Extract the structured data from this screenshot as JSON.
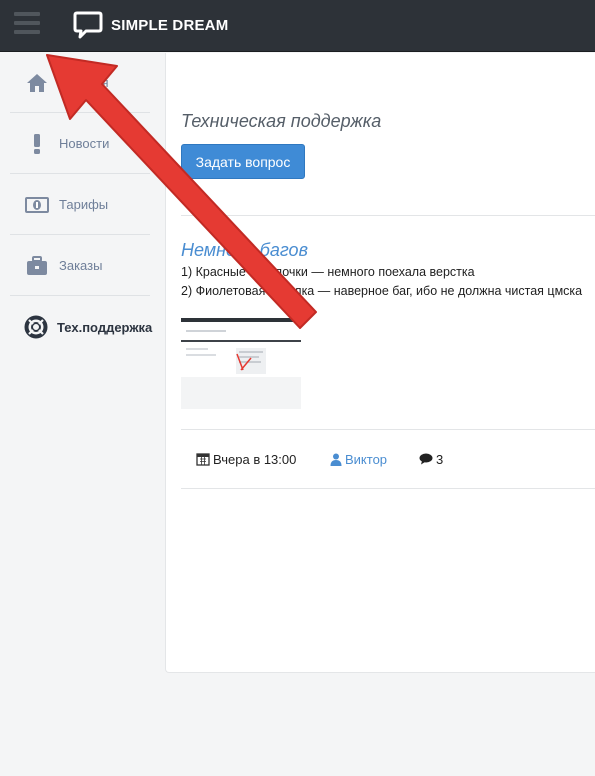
{
  "header": {
    "brand": "SIMPLE DREAM"
  },
  "sidebar": {
    "items": [
      {
        "label": "Главная",
        "icon": "home-icon"
      },
      {
        "label": "Новости",
        "icon": "exclamation-icon"
      },
      {
        "label": "Тарифы",
        "icon": "banknote-icon"
      },
      {
        "label": "Заказы",
        "icon": "briefcase-icon"
      },
      {
        "label": "Тех.поддержка",
        "icon": "lifebuoy-icon"
      }
    ]
  },
  "main": {
    "title": "Техническая поддержка",
    "ask_button": "Задать вопрос",
    "topic": {
      "title": "Немного багов",
      "lines": [
        "1) Красные стрелочки — немного поехала верстка",
        "2) Фиолетовая стрелка — наверное баг, ибо не должна чистая цмска"
      ],
      "date": "Вчера в 13:00",
      "author": "Виктор",
      "comments": "3"
    }
  },
  "colors": {
    "topbar": "#2d3238",
    "accent": "#3f8bd6",
    "link": "#4a8dd1",
    "annotation_arrow": "#e53a33"
  }
}
